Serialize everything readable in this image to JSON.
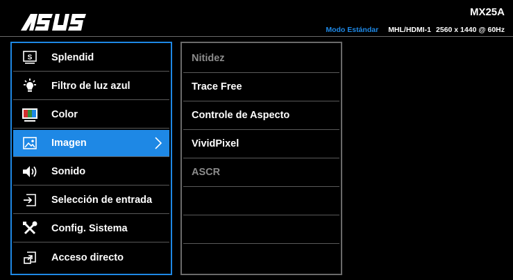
{
  "header": {
    "brand": "ASUS",
    "model": "MX25A",
    "mode": "Modo Estándar",
    "input": "MHL/HDMI-1",
    "resolution": "2560 x 1440 @ 60Hz"
  },
  "menu": {
    "items": [
      {
        "label": "Splendid",
        "icon": "splendid-icon"
      },
      {
        "label": "Filtro de luz azul",
        "icon": "blue-light-icon"
      },
      {
        "label": "Color",
        "icon": "color-icon"
      },
      {
        "label": "Imagen",
        "icon": "image-icon",
        "selected": true
      },
      {
        "label": "Sonido",
        "icon": "speaker-icon"
      },
      {
        "label": "Selección de entrada",
        "icon": "input-select-icon"
      },
      {
        "label": "Config. Sistema",
        "icon": "tools-icon"
      },
      {
        "label": "Acceso directo",
        "icon": "shortcut-icon"
      }
    ]
  },
  "submenu": {
    "items": [
      {
        "label": "Nitidez",
        "enabled": false
      },
      {
        "label": "Trace Free",
        "enabled": true
      },
      {
        "label": "Controle de Aspecto",
        "enabled": true
      },
      {
        "label": "VividPixel",
        "enabled": true
      },
      {
        "label": "ASCR",
        "enabled": false
      },
      {
        "label": "",
        "enabled": false
      },
      {
        "label": "",
        "enabled": false
      },
      {
        "label": "",
        "enabled": false
      }
    ]
  },
  "colors": {
    "accent": "#1e88e5",
    "background": "#000000",
    "disabled_text": "#8c8c8c"
  }
}
